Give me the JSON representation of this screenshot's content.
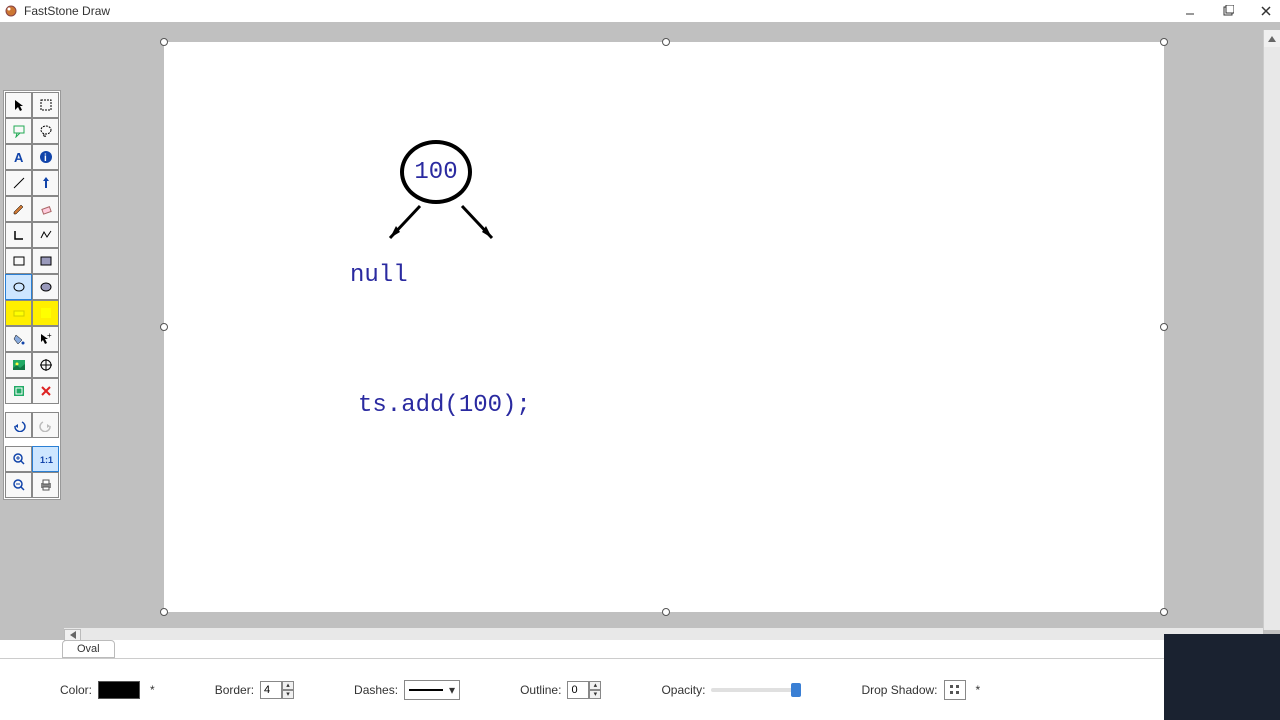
{
  "title": "FastStone Draw",
  "canvas": {
    "nodeValue": "100",
    "nullText": "null",
    "codeText": "ts.add(100);"
  },
  "statusTab": "Oval",
  "props": {
    "colorLabel": "Color:",
    "borderLabel": "Border:",
    "borderValue": "4",
    "dashesLabel": "Dashes:",
    "outlineLabel": "Outline:",
    "outlineValue": "0",
    "opacityLabel": "Opacity:",
    "shadowLabel": "Drop Shadow:"
  },
  "tools": [
    {
      "name": "pointer-tool",
      "icon": "pointer",
      "sel": false
    },
    {
      "name": "rect-select-tool",
      "icon": "rect-dash",
      "sel": false
    },
    {
      "name": "callout-tool",
      "icon": "callout",
      "sel": false
    },
    {
      "name": "free-select-tool",
      "icon": "lasso",
      "sel": false
    },
    {
      "name": "text-tool",
      "icon": "text",
      "sel": false
    },
    {
      "name": "info-tool",
      "icon": "info",
      "sel": false
    },
    {
      "name": "line-tool",
      "icon": "line",
      "sel": false
    },
    {
      "name": "arrow-tool",
      "icon": "arrow-up",
      "sel": false
    },
    {
      "name": "pencil-tool",
      "icon": "pencil",
      "sel": false
    },
    {
      "name": "eraser-tool",
      "icon": "eraser",
      "sel": false
    },
    {
      "name": "lshape-tool",
      "icon": "lshape",
      "sel": false
    },
    {
      "name": "polyline-tool",
      "icon": "poly",
      "sel": false
    },
    {
      "name": "rectangle-tool",
      "icon": "rect",
      "sel": false
    },
    {
      "name": "filled-rect-tool",
      "icon": "rect-fill",
      "sel": false
    },
    {
      "name": "oval-tool",
      "icon": "oval",
      "sel": true
    },
    {
      "name": "filled-oval-tool",
      "icon": "oval-fill",
      "sel": false
    },
    {
      "name": "highlighter-tool",
      "icon": "hl",
      "sel": false,
      "yellow": true
    },
    {
      "name": "fill-yellow-tool",
      "icon": "fill-y",
      "sel": false,
      "yellow": true
    },
    {
      "name": "bucket-tool",
      "icon": "bucket",
      "sel": false
    },
    {
      "name": "cursor-plus-tool",
      "icon": "cursor-plus",
      "sel": false
    },
    {
      "name": "image-tool",
      "icon": "image",
      "sel": false
    },
    {
      "name": "target-tool",
      "icon": "target",
      "sel": false
    },
    {
      "name": "crop-tool",
      "icon": "crop",
      "sel": false
    },
    {
      "name": "delete-tool",
      "icon": "xred",
      "sel": false
    }
  ],
  "tools2": [
    {
      "name": "undo-tool",
      "icon": "undo"
    },
    {
      "name": "redo-tool",
      "icon": "redo"
    }
  ],
  "tools3": [
    {
      "name": "zoom-in-tool",
      "icon": "zin"
    },
    {
      "name": "actual-size-tool",
      "icon": "z11",
      "sel": true
    },
    {
      "name": "zoom-out-tool",
      "icon": "zout"
    },
    {
      "name": "print-tool",
      "icon": "print"
    }
  ]
}
